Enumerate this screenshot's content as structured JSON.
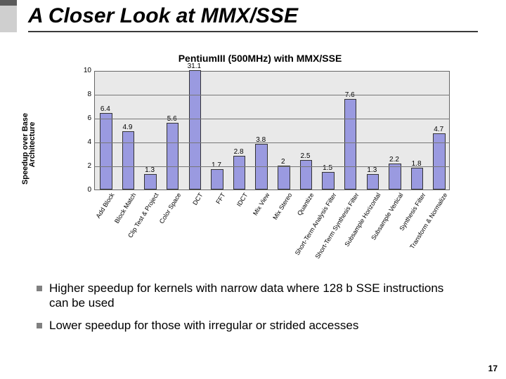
{
  "title": "A Closer Look at MMX/SSE",
  "chart_data": {
    "type": "bar",
    "title": "PentiumIII (500MHz) with MMX/SSE",
    "ylabel_line1": "Speedup over Base",
    "ylabel_line2": "Architecture",
    "ylim": [
      0,
      10
    ],
    "yticks": [
      0,
      2,
      4,
      6,
      8,
      10
    ],
    "categories": [
      "Add Block",
      "Block Match",
      "Clip Test & Project",
      "Color Space",
      "DCT",
      "FFT",
      "IDCT",
      "Mix View",
      "Mix Stereo",
      "Quantize",
      "Short-Term Analysis Filter",
      "Short-Term Synthesis Filter",
      "Subsample Horizontal",
      "Subsample Vertical",
      "Synthesis Filter",
      "Transform & Normalize"
    ],
    "values": [
      6.4,
      4.9,
      1.3,
      5.6,
      31.1,
      1.7,
      2.8,
      3.8,
      2,
      2.5,
      1.5,
      7.6,
      1.3,
      2.2,
      1.8,
      4.7
    ]
  },
  "bullets": [
    "Higher speedup for kernels with narrow data where 128 b SSE instructions can be used",
    "Lower speedup for those with irregular or strided accesses"
  ],
  "page_number": "17"
}
